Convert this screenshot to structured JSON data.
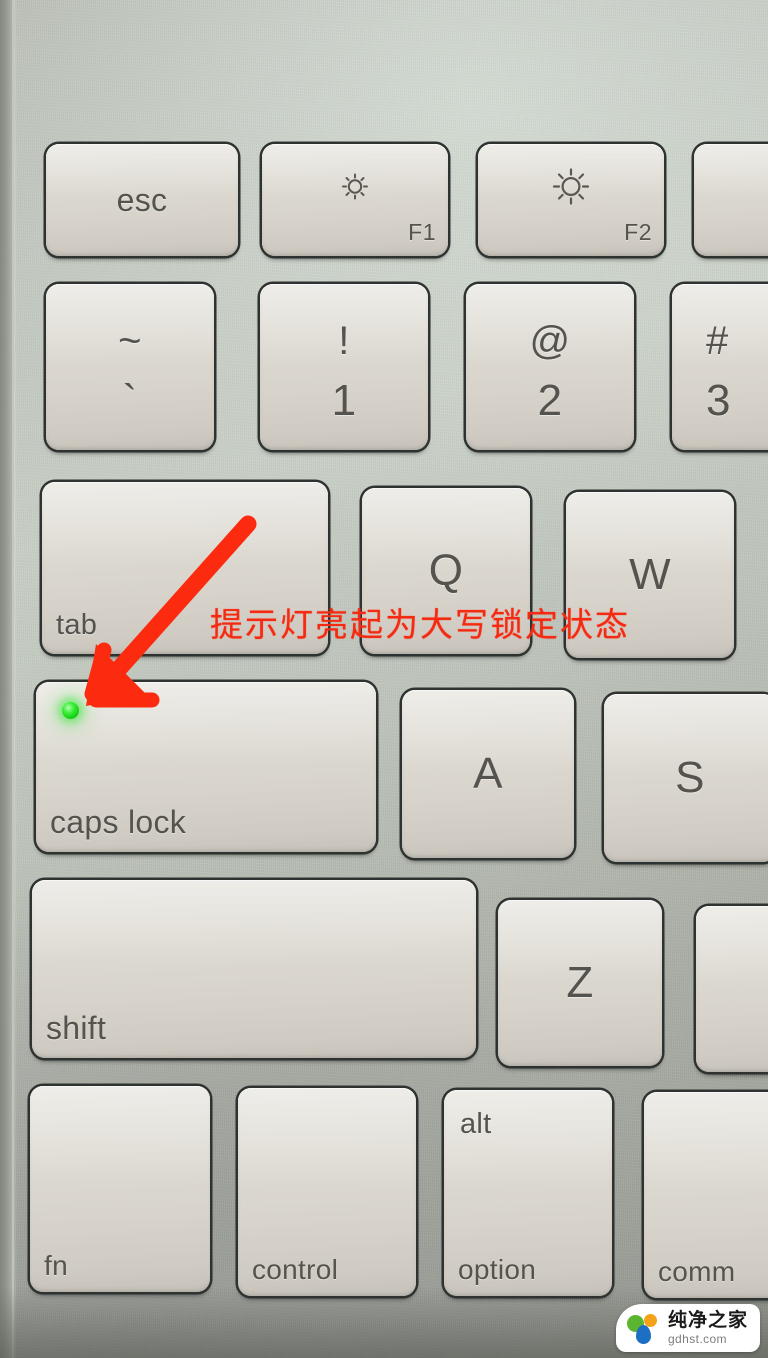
{
  "scene": {
    "subject": "macbook-keyboard-photo",
    "background_color": "#bfc5bc",
    "chassis_color": "#8d9188"
  },
  "annotation": {
    "note_text": "提示灯亮起为大写锁定状态",
    "note_color": "#f42b12",
    "arrow_color": "#fc2b10",
    "led_color": "#2ded2d",
    "led_state": "on"
  },
  "keyboard": {
    "rows": [
      {
        "name": "function-row",
        "keys": [
          {
            "id": "esc",
            "label": "esc",
            "sub": "",
            "fkey": "",
            "icon": ""
          },
          {
            "id": "f1",
            "label": "",
            "sub": "",
            "fkey": "F1",
            "icon": "brightness-down-icon"
          },
          {
            "id": "f2",
            "label": "",
            "sub": "",
            "fkey": "F2",
            "icon": "brightness-up-icon"
          },
          {
            "id": "f3",
            "label": "",
            "sub": "",
            "fkey": "",
            "icon": ""
          }
        ]
      },
      {
        "name": "number-row",
        "keys": [
          {
            "id": "tilde",
            "label": "~",
            "sub": "`",
            "fkey": "",
            "icon": ""
          },
          {
            "id": "one",
            "label": "!",
            "sub": "1",
            "fkey": "",
            "icon": ""
          },
          {
            "id": "two",
            "label": "@",
            "sub": "2",
            "fkey": "",
            "icon": ""
          },
          {
            "id": "three",
            "label": "#",
            "sub": "3",
            "fkey": "",
            "icon": ""
          }
        ]
      },
      {
        "name": "tab-row",
        "keys": [
          {
            "id": "tab",
            "label": "tab",
            "sub": "",
            "fkey": "",
            "icon": ""
          },
          {
            "id": "q",
            "label": "Q",
            "sub": "",
            "fkey": "",
            "icon": ""
          },
          {
            "id": "w",
            "label": "W",
            "sub": "",
            "fkey": "",
            "icon": ""
          }
        ]
      },
      {
        "name": "home-row",
        "keys": [
          {
            "id": "capslock",
            "label": "caps lock",
            "sub": "",
            "fkey": "",
            "icon": "caps-lock-led-icon"
          },
          {
            "id": "a",
            "label": "A",
            "sub": "",
            "fkey": "",
            "icon": ""
          },
          {
            "id": "s",
            "label": "S",
            "sub": "",
            "fkey": "",
            "icon": ""
          }
        ]
      },
      {
        "name": "shift-row",
        "keys": [
          {
            "id": "shift",
            "label": "shift",
            "sub": "",
            "fkey": "",
            "icon": ""
          },
          {
            "id": "z",
            "label": "Z",
            "sub": "",
            "fkey": "",
            "icon": ""
          },
          {
            "id": "x",
            "label": "",
            "sub": "",
            "fkey": "",
            "icon": ""
          }
        ]
      },
      {
        "name": "modifier-row",
        "keys": [
          {
            "id": "fn",
            "label": "fn",
            "sub": "",
            "fkey": "",
            "icon": ""
          },
          {
            "id": "control",
            "label": "control",
            "sub": "",
            "fkey": "",
            "icon": ""
          },
          {
            "id": "option",
            "label": "alt",
            "sub": "option",
            "fkey": "",
            "icon": ""
          },
          {
            "id": "command",
            "label": "comm",
            "sub": "",
            "fkey": "",
            "icon": ""
          }
        ]
      }
    ]
  },
  "watermark": {
    "brand_cn": "纯净之家",
    "brand_url": "gdhst.com",
    "logo_colors": {
      "green": "#5cb531",
      "orange": "#f5a21b",
      "blue": "#1d6fc4"
    }
  }
}
